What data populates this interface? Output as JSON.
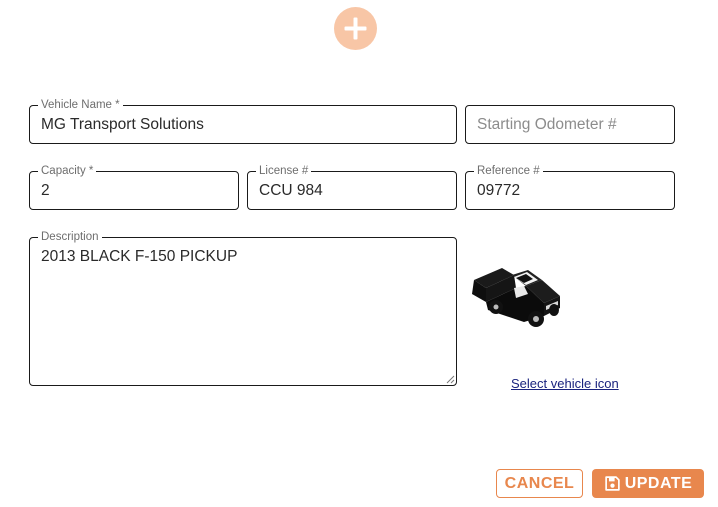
{
  "add_button": {
    "icon": "plus-circle-icon",
    "color": "#f8c6a6"
  },
  "form": {
    "vehicle_name": {
      "label": "Vehicle Name *",
      "value": "MG Transport Solutions"
    },
    "starting_odometer": {
      "placeholder": "Starting Odometer #"
    },
    "capacity": {
      "label": "Capacity *",
      "value": "2"
    },
    "license": {
      "label": "License #",
      "value": "CCU 984"
    },
    "reference": {
      "label": "Reference #",
      "value": "09772"
    },
    "description": {
      "label": "Description",
      "value": "2013 BLACK F-150 PICKUP"
    }
  },
  "vehicle_icon": {
    "icon": "pickup-truck-icon",
    "link_text": "Select vehicle icon"
  },
  "actions": {
    "cancel_label": "CANCEL",
    "update_label": "UPDATE",
    "update_icon": "save-icon",
    "accent_color": "#e8874d"
  }
}
